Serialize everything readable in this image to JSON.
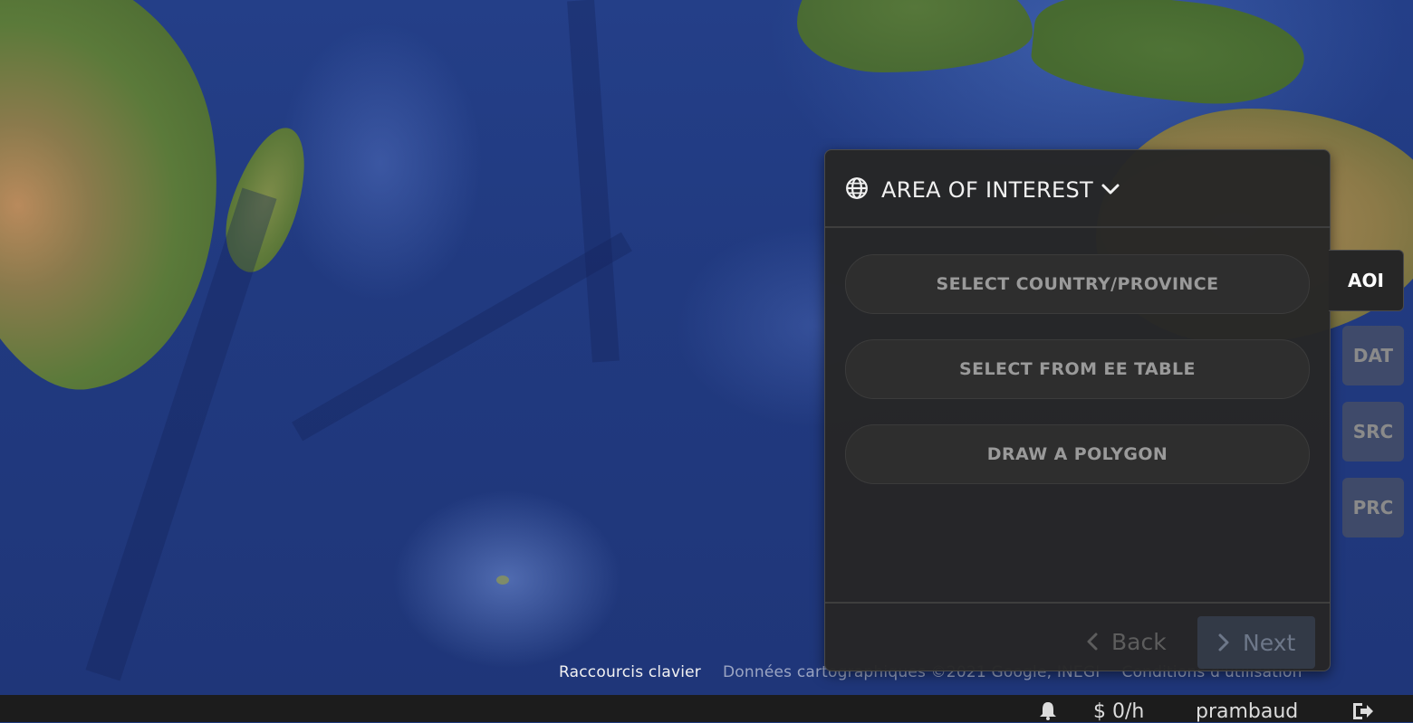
{
  "map": {
    "attribution": {
      "shortcuts": "Raccourcis clavier",
      "data": "Données cartographiques ©2021 Google, INEGI",
      "terms": "Conditions d'utilisation"
    }
  },
  "panel": {
    "title": "AREA OF INTEREST",
    "icon": "globe-icon",
    "options": [
      {
        "label": "SELECT COUNTRY/PROVINCE"
      },
      {
        "label": "SELECT FROM EE TABLE"
      },
      {
        "label": "DRAW A POLYGON"
      }
    ],
    "footer": {
      "back_label": "Back",
      "next_label": "Next"
    }
  },
  "side_tabs": [
    {
      "label": "AOI",
      "active": true
    },
    {
      "label": "DAT",
      "active": false
    },
    {
      "label": "SRC",
      "active": false
    },
    {
      "label": "PRC",
      "active": false
    }
  ],
  "statusbar": {
    "cost": "$ 0/h",
    "user": "prambaud"
  },
  "colors": {
    "panel_bg": "#262626",
    "next_bg": "#333a47",
    "ocean": "#213a80"
  }
}
